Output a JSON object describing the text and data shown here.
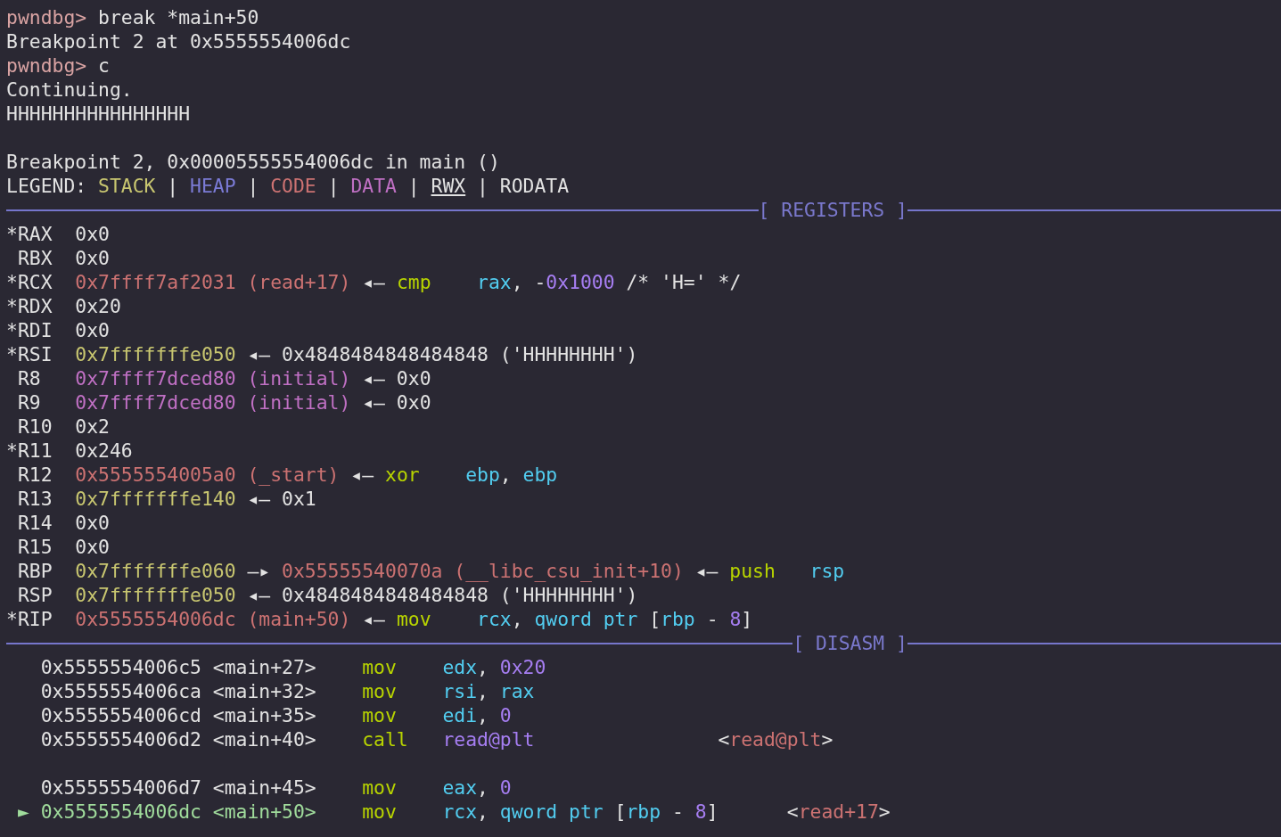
{
  "terminal": {
    "lines": [
      {
        "kind": "text",
        "segments": [
          {
            "t": "pwndbg> ",
            "kind": "prompt"
          },
          {
            "t": "break *main+50",
            "kind": "plain"
          }
        ]
      },
      {
        "kind": "text",
        "segments": [
          {
            "t": "Breakpoint 2 at 0x5555554006dc",
            "kind": "plain"
          }
        ]
      },
      {
        "kind": "text",
        "segments": [
          {
            "t": "pwndbg> ",
            "kind": "prompt"
          },
          {
            "t": "c",
            "kind": "plain"
          }
        ]
      },
      {
        "kind": "text",
        "segments": [
          {
            "t": "Continuing.",
            "kind": "plain"
          }
        ]
      },
      {
        "kind": "text",
        "segments": [
          {
            "t": "HHHHHHHHHHHHHHHH",
            "kind": "plain"
          }
        ]
      },
      {
        "kind": "blank"
      },
      {
        "kind": "text",
        "segments": [
          {
            "t": "Breakpoint 2, 0x00005555554006dc in main ()",
            "kind": "plain"
          }
        ]
      },
      {
        "kind": "text",
        "segments": [
          {
            "t": "LEGEND: ",
            "kind": "plain"
          },
          {
            "t": "STACK",
            "kind": "stack"
          },
          {
            "t": " | ",
            "kind": "plain"
          },
          {
            "t": "HEAP",
            "kind": "heap"
          },
          {
            "t": " | ",
            "kind": "plain"
          },
          {
            "t": "CODE",
            "kind": "code"
          },
          {
            "t": " | ",
            "kind": "plain"
          },
          {
            "t": "DATA",
            "kind": "data"
          },
          {
            "t": " | ",
            "kind": "plain"
          },
          {
            "t": "RWX",
            "kind": "rwx"
          },
          {
            "t": " | RODATA",
            "kind": "plain"
          }
        ]
      },
      {
        "kind": "banner",
        "label": "[ REGISTERS ]"
      },
      {
        "kind": "text",
        "segments": [
          {
            "t": "*RAX  0x0",
            "kind": "plain"
          }
        ]
      },
      {
        "kind": "text",
        "segments": [
          {
            "t": " RBX  0x0",
            "kind": "plain"
          }
        ]
      },
      {
        "kind": "text",
        "segments": [
          {
            "t": "*RCX  ",
            "kind": "plain"
          },
          {
            "t": "0x7ffff7af2031 (read+17)",
            "kind": "code"
          },
          {
            "t": " ◂— ",
            "kind": "plain"
          },
          {
            "t": "cmp    ",
            "kind": "mnemonic"
          },
          {
            "t": "rax",
            "kind": "register"
          },
          {
            "t": ", -",
            "kind": "plain"
          },
          {
            "t": "0x1000",
            "kind": "number"
          },
          {
            "t": " /* 'H=' */",
            "kind": "plain"
          }
        ]
      },
      {
        "kind": "text",
        "segments": [
          {
            "t": "*RDX  0x20",
            "kind": "plain"
          }
        ]
      },
      {
        "kind": "text",
        "segments": [
          {
            "t": "*RDI  0x0",
            "kind": "plain"
          }
        ]
      },
      {
        "kind": "text",
        "segments": [
          {
            "t": "*RSI  ",
            "kind": "plain"
          },
          {
            "t": "0x7fffffffe050",
            "kind": "stack"
          },
          {
            "t": " ◂— 0x4848484848484848 ('HHHHHHHH')",
            "kind": "plain"
          }
        ]
      },
      {
        "kind": "text",
        "segments": [
          {
            "t": " R8   ",
            "kind": "plain"
          },
          {
            "t": "0x7ffff7dced80 (initial)",
            "kind": "data"
          },
          {
            "t": " ◂— 0x0",
            "kind": "plain"
          }
        ]
      },
      {
        "kind": "text",
        "segments": [
          {
            "t": " R9   ",
            "kind": "plain"
          },
          {
            "t": "0x7ffff7dced80 (initial)",
            "kind": "data"
          },
          {
            "t": " ◂— 0x0",
            "kind": "plain"
          }
        ]
      },
      {
        "kind": "text",
        "segments": [
          {
            "t": " R10  0x2",
            "kind": "plain"
          }
        ]
      },
      {
        "kind": "text",
        "segments": [
          {
            "t": "*R11  0x246",
            "kind": "plain"
          }
        ]
      },
      {
        "kind": "text",
        "segments": [
          {
            "t": " R12  ",
            "kind": "plain"
          },
          {
            "t": "0x5555554005a0 (_start)",
            "kind": "code"
          },
          {
            "t": " ◂— ",
            "kind": "plain"
          },
          {
            "t": "xor    ",
            "kind": "mnemonic"
          },
          {
            "t": "ebp",
            "kind": "register"
          },
          {
            "t": ", ",
            "kind": "plain"
          },
          {
            "t": "ebp",
            "kind": "register"
          }
        ]
      },
      {
        "kind": "text",
        "segments": [
          {
            "t": " R13  ",
            "kind": "plain"
          },
          {
            "t": "0x7fffffffe140",
            "kind": "stack"
          },
          {
            "t": " ◂— 0x1",
            "kind": "plain"
          }
        ]
      },
      {
        "kind": "text",
        "segments": [
          {
            "t": " R14  0x0",
            "kind": "plain"
          }
        ]
      },
      {
        "kind": "text",
        "segments": [
          {
            "t": " R15  0x0",
            "kind": "plain"
          }
        ]
      },
      {
        "kind": "text",
        "segments": [
          {
            "t": " RBP  ",
            "kind": "plain"
          },
          {
            "t": "0x7fffffffe060",
            "kind": "stack"
          },
          {
            "t": " —▸ ",
            "kind": "plain"
          },
          {
            "t": "0x55555540070a (__libc_csu_init+10)",
            "kind": "code"
          },
          {
            "t": " ◂— ",
            "kind": "plain"
          },
          {
            "t": "push   ",
            "kind": "mnemonic"
          },
          {
            "t": "rsp",
            "kind": "register"
          }
        ]
      },
      {
        "kind": "text",
        "segments": [
          {
            "t": " RSP  ",
            "kind": "plain"
          },
          {
            "t": "0x7fffffffe050",
            "kind": "stack"
          },
          {
            "t": " ◂— 0x4848484848484848 ('HHHHHHHH')",
            "kind": "plain"
          }
        ]
      },
      {
        "kind": "text",
        "segments": [
          {
            "t": "*RIP  ",
            "kind": "plain"
          },
          {
            "t": "0x5555554006dc (main+50)",
            "kind": "code"
          },
          {
            "t": " ◂— ",
            "kind": "plain"
          },
          {
            "t": "mov    ",
            "kind": "mnemonic"
          },
          {
            "t": "rcx",
            "kind": "register"
          },
          {
            "t": ", ",
            "kind": "plain"
          },
          {
            "t": "qword ptr",
            "kind": "register"
          },
          {
            "t": " [",
            "kind": "plain"
          },
          {
            "t": "rbp",
            "kind": "register"
          },
          {
            "t": " - ",
            "kind": "plain"
          },
          {
            "t": "8",
            "kind": "number"
          },
          {
            "t": "]",
            "kind": "plain"
          }
        ]
      },
      {
        "kind": "banner",
        "label": "[ DISASM ]"
      },
      {
        "kind": "text",
        "segments": [
          {
            "t": "   0x5555554006c5 <main+27>    ",
            "kind": "plain"
          },
          {
            "t": "mov    ",
            "kind": "mnemonic"
          },
          {
            "t": "edx",
            "kind": "register"
          },
          {
            "t": ", ",
            "kind": "plain"
          },
          {
            "t": "0x20",
            "kind": "number"
          }
        ]
      },
      {
        "kind": "text",
        "segments": [
          {
            "t": "   0x5555554006ca <main+32>    ",
            "kind": "plain"
          },
          {
            "t": "mov    ",
            "kind": "mnemonic"
          },
          {
            "t": "rsi",
            "kind": "register"
          },
          {
            "t": ", ",
            "kind": "plain"
          },
          {
            "t": "rax",
            "kind": "register"
          }
        ]
      },
      {
        "kind": "text",
        "segments": [
          {
            "t": "   0x5555554006cd <main+35>    ",
            "kind": "plain"
          },
          {
            "t": "mov    ",
            "kind": "mnemonic"
          },
          {
            "t": "edi",
            "kind": "register"
          },
          {
            "t": ", ",
            "kind": "plain"
          },
          {
            "t": "0",
            "kind": "number"
          }
        ]
      },
      {
        "kind": "text",
        "segments": [
          {
            "t": "   0x5555554006d2 <main+40>    ",
            "kind": "plain"
          },
          {
            "t": "call   ",
            "kind": "mnemonic"
          },
          {
            "t": "read@plt",
            "kind": "number"
          },
          {
            "t": "                <",
            "kind": "plain"
          },
          {
            "t": "read@plt",
            "kind": "code"
          },
          {
            "t": ">",
            "kind": "plain"
          }
        ]
      },
      {
        "kind": "blank"
      },
      {
        "kind": "text",
        "segments": [
          {
            "t": "   0x5555554006d7 <main+45>    ",
            "kind": "plain"
          },
          {
            "t": "mov    ",
            "kind": "mnemonic"
          },
          {
            "t": "eax",
            "kind": "register"
          },
          {
            "t": ", ",
            "kind": "plain"
          },
          {
            "t": "0",
            "kind": "number"
          }
        ]
      },
      {
        "kind": "text",
        "segments": [
          {
            "t": " ► 0x5555554006dc <main+50>",
            "kind": "current"
          },
          {
            "t": "    mov    ",
            "kind": "mnemonic"
          },
          {
            "t": "rcx",
            "kind": "register"
          },
          {
            "t": ", ",
            "kind": "plain"
          },
          {
            "t": "qword ptr",
            "kind": "register"
          },
          {
            "t": " [",
            "kind": "plain"
          },
          {
            "t": "rbp",
            "kind": "register"
          },
          {
            "t": " - ",
            "kind": "plain"
          },
          {
            "t": "8",
            "kind": "number"
          },
          {
            "t": "]      <",
            "kind": "plain"
          },
          {
            "t": "read+17",
            "kind": "code"
          },
          {
            "t": ">",
            "kind": "plain"
          }
        ]
      }
    ]
  }
}
